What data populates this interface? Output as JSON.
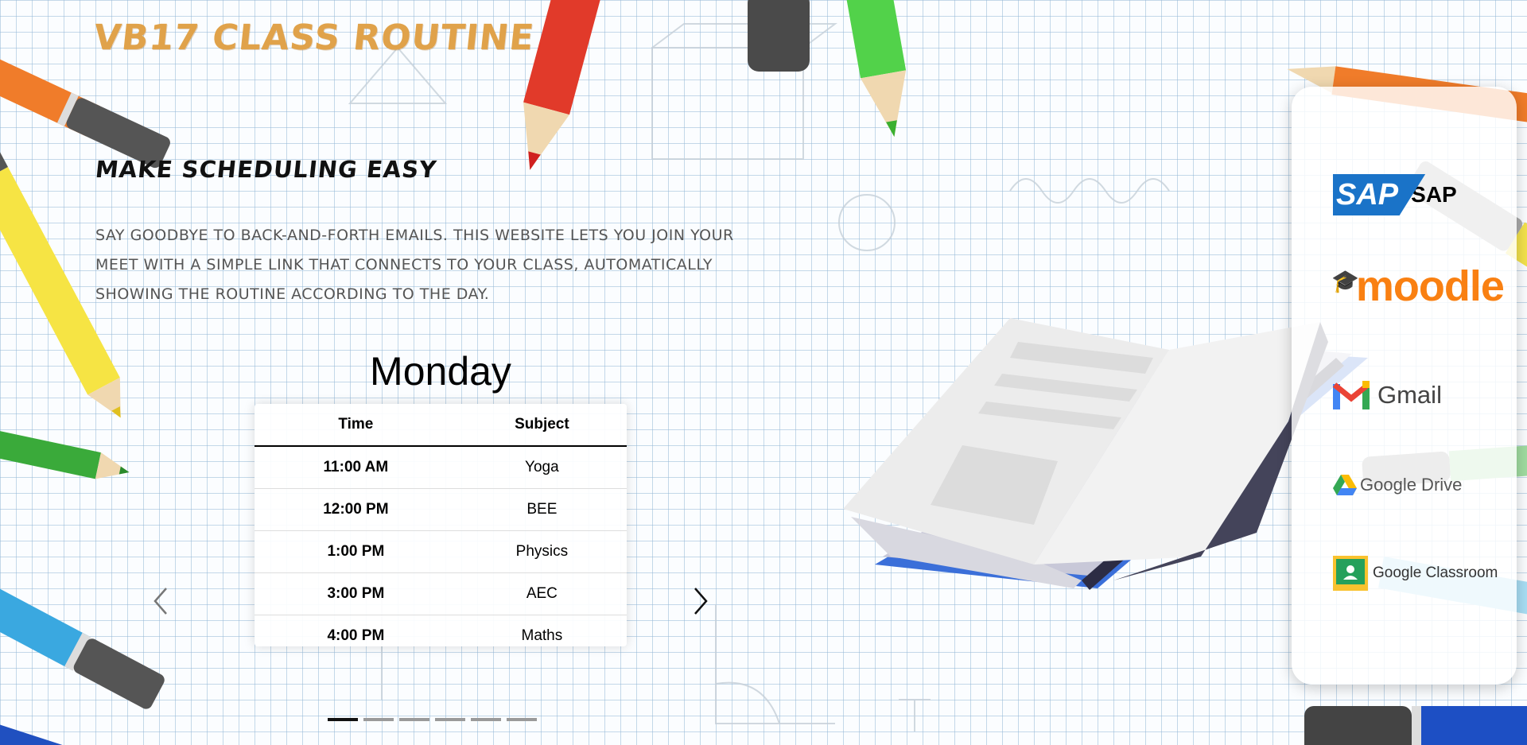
{
  "header": {
    "title": "VB17 CLASS ROUTINE",
    "subtitle": "MAKE SCHEDULING EASY",
    "description": "SAY GOODBYE TO BACK-AND-FORTH EMAILS. THIS WEBSITE LETS YOU JOIN YOUR MEET WITH A SIMPLE LINK THAT CONNECTS TO YOUR CLASS, AUTOMATICALLY SHOWING THE ROUTINE ACCORDING TO THE DAY."
  },
  "schedule": {
    "day": "Monday",
    "columns": [
      "Time",
      "Subject"
    ],
    "rows": [
      {
        "time": "11:00 AM",
        "subject": "Yoga"
      },
      {
        "time": "12:00 PM",
        "subject": "BEE"
      },
      {
        "time": "1:00 PM",
        "subject": "Physics"
      },
      {
        "time": "3:00 PM",
        "subject": "AEC"
      },
      {
        "time": "4:00 PM",
        "subject": "Maths"
      }
    ],
    "slides": {
      "total": 6,
      "active": 1
    }
  },
  "links": {
    "sap": {
      "logo_text": "SAP",
      "label": "SAP"
    },
    "moodle": {
      "label": "moodle"
    },
    "gmail": {
      "label": "Gmail"
    },
    "drive": {
      "label": "Google Drive"
    },
    "classroom": {
      "label": "Google Classroom"
    }
  },
  "colors": {
    "title": "#e0a24a",
    "sap_blue": "#1a73c8",
    "moodle_orange": "#f98012",
    "accent_dot": "#111111"
  }
}
